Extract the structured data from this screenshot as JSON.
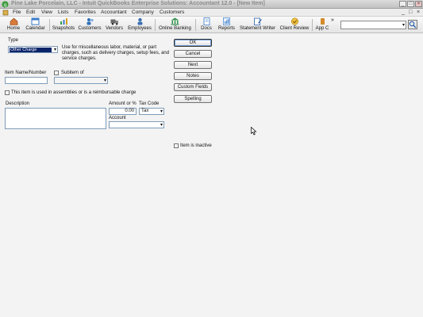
{
  "window": {
    "title": "Pine Lake Porcelain, LLC  -  Intuit QuickBooks Enterprise Solutions: Accountant 12.0 - [New Item]",
    "minimize": "_",
    "maximize": "□",
    "close": "×",
    "inner_minimize": "_",
    "inner_restore": "□",
    "inner_close": "×"
  },
  "menu": {
    "items": [
      "File",
      "Edit",
      "View",
      "Lists",
      "Favorites",
      "Accountant",
      "Company",
      "Customers"
    ]
  },
  "toolbar": {
    "items": [
      {
        "label": "Home",
        "icon": "house-icon",
        "color": "#c9662a"
      },
      {
        "label": "Calendar",
        "icon": "calendar-icon",
        "color": "#3a7bc8"
      },
      {
        "label": "Snapshots",
        "icon": "chart-icon",
        "color": "#3a9a4a"
      },
      {
        "label": "Customers",
        "icon": "people-icon",
        "color": "#2f6fb7"
      },
      {
        "label": "Vendors",
        "icon": "truck-icon",
        "color": "#5a5a5a"
      },
      {
        "label": "Employees",
        "icon": "person-icon",
        "color": "#3b6fb0"
      },
      {
        "label": "Online Banking",
        "icon": "bank-icon",
        "color": "#2f8f4a"
      },
      {
        "label": "Docs",
        "icon": "document-icon",
        "color": "#3a7bc8"
      },
      {
        "label": "Reports",
        "icon": "report-icon",
        "color": "#4e8bd0"
      },
      {
        "label": "Statement Writer",
        "icon": "writer-icon",
        "color": "#2b5fa8"
      },
      {
        "label": "Client Review",
        "icon": "review-icon",
        "color": "#d6a21a"
      },
      {
        "label": "App C",
        "icon": "app-center-icon",
        "color": "#d58a2a"
      }
    ],
    "more": "»"
  },
  "search": {
    "value": "",
    "arrow": "▾"
  },
  "form": {
    "type_label": "Type",
    "type_value": "Other Charge",
    "type_description": "Use for miscellaneous labor, material, or part charges, such as delivery charges, setup fees, and service charges.",
    "item_name_label": "Item Name/Number",
    "item_name_value": "",
    "subitem_label": "Subitem of",
    "subitem_value": "",
    "assembly_label": "This item is used in assemblies or is a reimbursable charge",
    "description_label": "Description",
    "description_value": "",
    "amount_label": "Amount or %",
    "amount_value": "0.00",
    "tax_code_label": "Tax Code",
    "tax_code_value": "Tax",
    "account_label": "Account",
    "account_value": "",
    "inactive_label": "Item is inactive",
    "dropdown_arrow": "▾"
  },
  "buttons": {
    "ok": "OK",
    "cancel": "Cancel",
    "next": "Next",
    "notes": "Notes",
    "custom_fields": "Custom Fields",
    "spelling": "Spelling"
  }
}
